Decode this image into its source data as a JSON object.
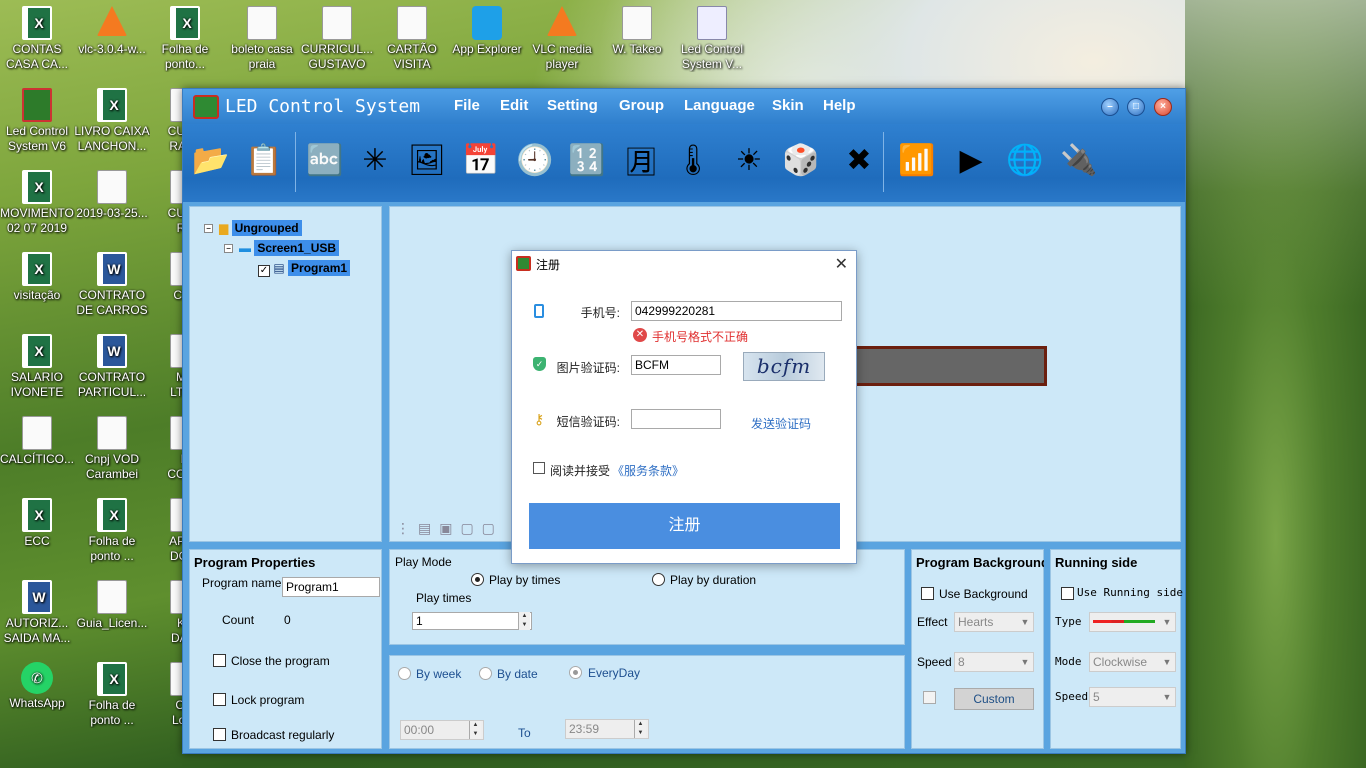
{
  "desktop": {
    "icons": [
      {
        "label": "CONTAS",
        "label2": "CASA CA...",
        "type": "xls"
      },
      {
        "label": "vlc-3.0.4-w...",
        "label2": "",
        "type": "vlc"
      },
      {
        "label": "Folha de",
        "label2": "ponto...",
        "type": "xls"
      },
      {
        "label": "boleto casa",
        "label2": "praia",
        "type": "paper"
      },
      {
        "label": "CURRICUL...",
        "label2": "GUSTAVO",
        "type": "paper"
      },
      {
        "label": "CARTÃO",
        "label2": "VISITA",
        "type": "paper"
      },
      {
        "label": "App Explorer",
        "label2": "",
        "type": "app"
      },
      {
        "label": "VLC media",
        "label2": "player",
        "type": "vlc"
      },
      {
        "label": "W. Takeo",
        "label2": "",
        "type": "paper"
      },
      {
        "label": "Led Control",
        "label2": "System V...",
        "type": "ctrl"
      },
      {
        "label": "Led Control",
        "label2": "System V6",
        "type": "led"
      },
      {
        "label": "LIVRO CAIXA",
        "label2": "LANCHON...",
        "type": "xls"
      },
      {
        "label": "CURR",
        "label2": "RAFA",
        "type": "paper"
      },
      {
        "label": "MOVIMENTO",
        "label2": "02 07 2019",
        "type": "xls"
      },
      {
        "label": "2019-03-25...",
        "label2": "",
        "type": "paper"
      },
      {
        "label": "CURR",
        "label2": "RA",
        "type": "paper"
      },
      {
        "label": "visitação",
        "label2": "",
        "type": "xls"
      },
      {
        "label": "CONTRATO",
        "label2": "DE CARROS",
        "type": "doc"
      },
      {
        "label": "Curr",
        "label2": "",
        "type": "paper"
      },
      {
        "label": "SALARIO",
        "label2": "IVONETE",
        "type": "xls"
      },
      {
        "label": "CONTRATO",
        "label2": "PARTICUL...",
        "type": "doc"
      },
      {
        "label": "MA",
        "label2": "LTDA",
        "type": "paper"
      },
      {
        "label": "CALCÍTICO...",
        "label2": "",
        "type": "paper"
      },
      {
        "label": "Cnpj VOD",
        "label2": "Carambei",
        "type": "paper"
      },
      {
        "label": "R",
        "label2": "CONC",
        "type": "paper"
      },
      {
        "label": "ECC",
        "label2": "",
        "type": "xls"
      },
      {
        "label": "Folha de",
        "label2": "ponto ...",
        "type": "xls"
      },
      {
        "label": "APAR",
        "label2": "DO N",
        "type": "paper"
      },
      {
        "label": "AUTORIZ...",
        "label2": "SAIDA MA...",
        "type": "doc"
      },
      {
        "label": "Guia_Licen...",
        "label2": "",
        "type": "paper"
      },
      {
        "label": "KE",
        "label2": "DAIA",
        "type": "paper"
      },
      {
        "label": "WhatsApp",
        "label2": "",
        "type": "wa"
      },
      {
        "label": "Folha de",
        "label2": "ponto ...",
        "type": "xls"
      },
      {
        "label": "Cor",
        "label2": "Loca",
        "type": "paper"
      }
    ]
  },
  "window": {
    "title": "LED Control System",
    "menu": [
      "File",
      "Edit",
      "Setting",
      "Group",
      "Language",
      "Skin",
      "Help"
    ],
    "toolbar": [
      {
        "icon": "folder-open-icon",
        "glyph": "📂"
      },
      {
        "icon": "program-list-icon",
        "glyph": "📋"
      },
      {
        "icon": "text-icon",
        "glyph": "🔤"
      },
      {
        "icon": "animation-icon",
        "glyph": "✳"
      },
      {
        "icon": "picture-icon",
        "glyph": "🖼"
      },
      {
        "icon": "calendar-icon",
        "glyph": "📅"
      },
      {
        "icon": "analog-clock-icon",
        "glyph": "🕘"
      },
      {
        "icon": "digital-clock-icon",
        "glyph": "🔢"
      },
      {
        "icon": "lunar-calendar-icon",
        "glyph": "🈷"
      },
      {
        "icon": "thermometer-icon",
        "glyph": "🌡"
      },
      {
        "icon": "weather-sun-icon",
        "glyph": "☀"
      },
      {
        "icon": "counter-icon",
        "glyph": "🎲"
      },
      {
        "icon": "delete-icon",
        "glyph": "✖"
      },
      {
        "icon": "wireless-send-icon",
        "glyph": "📶"
      },
      {
        "icon": "preview-play-icon",
        "glyph": "▶"
      },
      {
        "icon": "network-globe-icon",
        "glyph": "🌐"
      },
      {
        "icon": "usb-drive-icon",
        "glyph": "🔌"
      }
    ]
  },
  "tree": {
    "group": "Ungrouped",
    "screen": "Screen1_USB",
    "program": "Program1"
  },
  "program_properties": {
    "title": "Program Properties",
    "name_label": "Program name",
    "name_value": "Program1",
    "count_label": "Count",
    "count_value": "0",
    "close_label": "Close the program",
    "lock_label": "Lock program",
    "broadcast_label": "Broadcast regularly"
  },
  "play_mode": {
    "title": "Play Mode",
    "by_times": "Play by times",
    "by_duration": "Play by duration",
    "times_label": "Play times",
    "times_value": "1"
  },
  "schedule": {
    "by_week": "By week",
    "by_date": "By date",
    "everyday": "EveryDay",
    "start": "00:00",
    "to": "To",
    "end": "23:59"
  },
  "program_background": {
    "title": "Program Background",
    "use_label": "Use Background",
    "effect_label": "Effect",
    "effect_value": "Hearts",
    "speed_label": "Speed",
    "speed_value": "8",
    "custom_button": "Custom"
  },
  "running_side": {
    "title": "Running side",
    "use_label": "Use Running side",
    "type_label": "Type",
    "mode_label": "Mode",
    "mode_value": "Clockwise",
    "speed_label": "Speed",
    "speed_value": "5"
  },
  "dialog": {
    "title": "注册",
    "phone_label": "手机号:",
    "phone_value": "042999220281",
    "error_text": "手机号格式不正确",
    "captcha_label": "图片验证码:",
    "captcha_value": "BCFM",
    "captcha_image_text": "bcfm",
    "sms_label": "短信验证码:",
    "sms_value": "",
    "send_code": "发送验证码",
    "agree_text": "阅读并接受",
    "terms_link": "《服务条款》",
    "register_button": "注册"
  }
}
